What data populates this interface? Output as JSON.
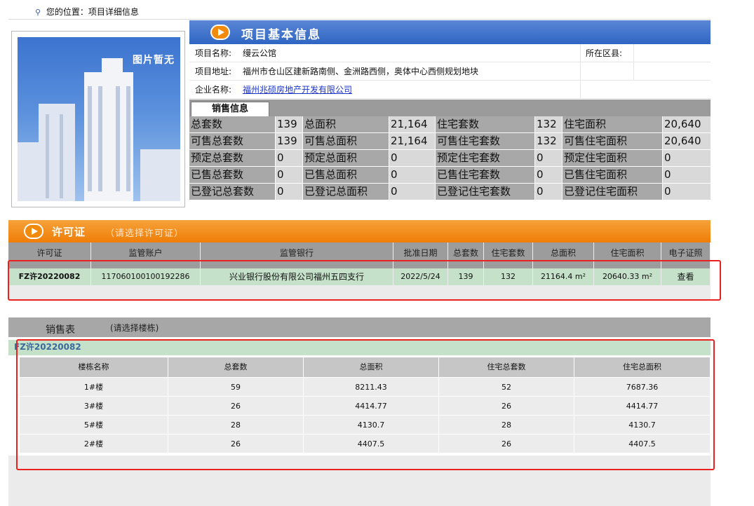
{
  "breadcrumb": {
    "text": "您的位置：项目详细信息"
  },
  "photo": {
    "placeholder": "图片暂无"
  },
  "basic_info": {
    "title": "项目基本信息",
    "project_name_label": "项目名称:",
    "project_name": "缦云公馆",
    "district_label": "所在区县:",
    "district": "",
    "address_label": "项目地址:",
    "address": "福州市仓山区建新路南侧、金洲路西侧，奥体中心西侧规划地块",
    "company_label": "企业名称:",
    "company": "福州兆硕房地产开发有限公司"
  },
  "sales_info": {
    "tab": "销售信息",
    "rows": [
      [
        {
          "l": "总套数",
          "v": "139"
        },
        {
          "l": "总面积",
          "v": "21,164"
        },
        {
          "l": "住宅套数",
          "v": "132"
        },
        {
          "l": "住宅面积",
          "v": "20,640"
        }
      ],
      [
        {
          "l": "可售总套数",
          "v": "139"
        },
        {
          "l": "可售总面积",
          "v": "21,164"
        },
        {
          "l": "可售住宅套数",
          "v": "132"
        },
        {
          "l": "可售住宅面积",
          "v": "20,640"
        }
      ],
      [
        {
          "l": "预定总套数",
          "v": "0"
        },
        {
          "l": "预定总面积",
          "v": "0"
        },
        {
          "l": "预定住宅套数",
          "v": "0"
        },
        {
          "l": "预定住宅面积",
          "v": "0"
        }
      ],
      [
        {
          "l": "已售总套数",
          "v": "0"
        },
        {
          "l": "已售总面积",
          "v": "0"
        },
        {
          "l": "已售住宅套数",
          "v": "0"
        },
        {
          "l": "已售住宅面积",
          "v": "0"
        }
      ],
      [
        {
          "l": "已登记总套数",
          "v": "0"
        },
        {
          "l": "已登记总面积",
          "v": "0"
        },
        {
          "l": "已登记住宅套数",
          "v": "0"
        },
        {
          "l": "已登记住宅面积",
          "v": "0"
        }
      ]
    ]
  },
  "permit": {
    "title": "许可证",
    "hint": "（请选择许可证）",
    "headers": [
      "许可证",
      "监管账户",
      "监管银行",
      "批准日期",
      "总套数",
      "住宅套数",
      "总面积",
      "住宅面积",
      "电子证照"
    ],
    "row": {
      "permit_no": "FZ许20220082",
      "account": "117060100100192286",
      "bank": "兴业银行股份有限公司福州五四支行",
      "date": "2022/5/24",
      "total_units": "139",
      "res_units": "132",
      "total_area": "21164.4 m²",
      "res_area": "20640.33 m²",
      "view_link": "查看"
    }
  },
  "sales_table": {
    "title": "销售表",
    "hint": "(请选择楼栋)",
    "selected_permit": "FZ许20220082",
    "headers": [
      "楼栋名称",
      "总套数",
      "总面积",
      "住宅总套数",
      "住宅总面积"
    ],
    "rows": [
      [
        "1#楼",
        "59",
        "8211.43",
        "52",
        "7687.36"
      ],
      [
        "3#楼",
        "26",
        "4414.77",
        "26",
        "4414.77"
      ],
      [
        "5#楼",
        "28",
        "4130.7",
        "28",
        "4130.7"
      ],
      [
        "2#楼",
        "26",
        "4407.5",
        "26",
        "4407.5"
      ]
    ]
  },
  "colors": {
    "blue_banner": "#2f66c3",
    "orange_banner": "#ef7d07",
    "green_row": "#c5e1c9",
    "highlight": "#e8221e",
    "link": "#1a33c8"
  }
}
